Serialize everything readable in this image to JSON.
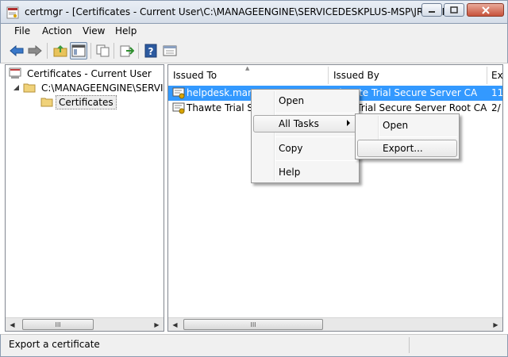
{
  "window": {
    "title": "certmgr - [Certificates - Current User\\C:\\MANAGEENGINE\\SERVICEDESKPLUS-MSP\\JRE\\BIN..."
  },
  "menubar": {
    "items": [
      "File",
      "Action",
      "View",
      "Help"
    ]
  },
  "toolbar": {
    "buttons": [
      "back-icon",
      "forward-icon",
      "up-folder-icon",
      "show-hide-tree-icon",
      "copy-icon",
      "export-list-icon",
      "help-icon",
      "properties-icon"
    ]
  },
  "tree": {
    "root": "Certificates - Current User",
    "store": "C:\\MANAGEENGINE\\SERVICEDESKPLUS-MSP\\JRE\\BIN",
    "store_display": "C:\\MANAGEENGINE\\SERVICE",
    "child": "Certificates"
  },
  "list": {
    "columns": [
      "Issued To",
      "Issued By",
      "Ex"
    ],
    "rows": [
      {
        "issued_to": "helpdesk.mana",
        "issued_by": "Thawte Trial Secure Server CA",
        "expiration": "11"
      },
      {
        "issued_to": "Thawte Trial Se",
        "issued_by": "e Trial Secure Server Root CA",
        "expiration": "2/"
      }
    ]
  },
  "context_menu": {
    "items": [
      "Open",
      "All Tasks",
      "Copy",
      "Help"
    ]
  },
  "submenu": {
    "items": [
      "Open",
      "Export..."
    ]
  },
  "scrollbars": {
    "thumb_grip": "III"
  },
  "statusbar": {
    "text": "Export a certificate"
  },
  "colors": {
    "selection": "#3399ff",
    "titlebar": "#dbe3ee",
    "close_button": "#c7523b"
  }
}
